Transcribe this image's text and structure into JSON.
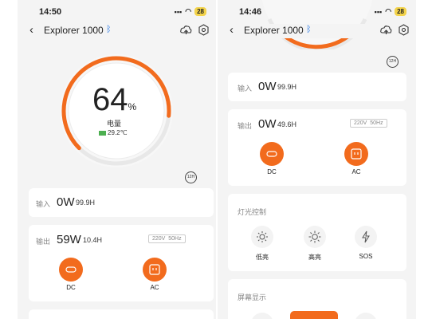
{
  "left": {
    "status": {
      "time": "14:50",
      "battery": "28"
    },
    "nav": {
      "title": "Explorer 1000"
    },
    "gauge": {
      "percent_value": "64",
      "percent_sign": "%",
      "label": "电量",
      "temp": "29.2℃",
      "fraction": 0.64
    },
    "h12_badge": "12H",
    "input": {
      "label": "输入",
      "watts": "0W",
      "hours": "99.9H"
    },
    "output": {
      "label": "输出",
      "watts": "59W",
      "hours": "10.4H",
      "voltage": "220V",
      "freq": "50Hz"
    },
    "buttons": {
      "dc": "DC",
      "ac": "AC"
    }
  },
  "right": {
    "status": {
      "time": "14:46",
      "battery": "28"
    },
    "nav": {
      "title": "Explorer 1000"
    },
    "h12_badge": "12H",
    "input": {
      "label": "输入",
      "watts": "0W",
      "hours": "99.9H"
    },
    "output": {
      "label": "输出",
      "watts": "0W",
      "hours": "49.6H",
      "voltage": "220V",
      "freq": "50Hz"
    },
    "buttons": {
      "dc": "DC",
      "ac": "AC"
    },
    "light": {
      "title": "灯光控制",
      "low": "低亮",
      "high": "高亮",
      "sos": "SOS"
    },
    "screen": {
      "title": "屏幕显示"
    }
  },
  "colors": {
    "accent": "#f26b1d",
    "bluetooth": "#2d7be5"
  }
}
